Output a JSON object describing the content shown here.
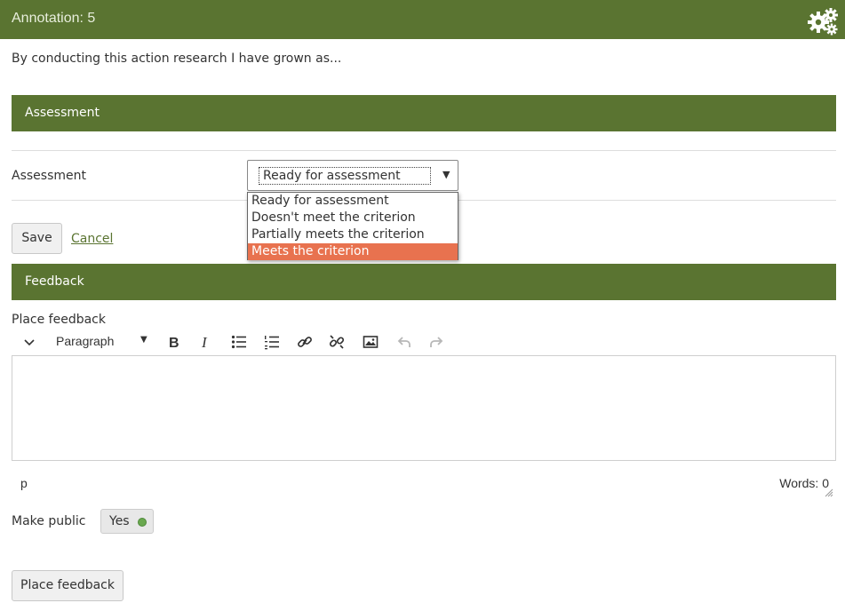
{
  "header": {
    "title": "Annotation: 5",
    "settings_icon": "gears-icon"
  },
  "intro_text": "By conducting this action research I have grown as...",
  "assessment_section": {
    "title": "Assessment",
    "field_label": "Assessment",
    "selected": "Ready for assessment",
    "options": [
      "Ready for assessment",
      "Doesn't meet the criterion",
      "Partially meets the criterion",
      "Meets the criterion"
    ],
    "highlighted_option": "Meets the criterion",
    "save_label": "Save",
    "cancel_label": "Cancel"
  },
  "feedback_section": {
    "title": "Feedback",
    "place_label": "Place feedback",
    "toolbar": {
      "block_format": "Paragraph",
      "icons": [
        "collapse-icon",
        "bold-icon",
        "italic-icon",
        "bullet-list-icon",
        "numbered-list-icon",
        "link-icon",
        "unlink-icon",
        "image-icon",
        "undo-icon",
        "redo-icon"
      ]
    },
    "status_path": "p",
    "word_count": "Words: 0",
    "make_public_label": "Make public",
    "make_public_value": "Yes",
    "submit_label": "Place feedback"
  },
  "colors": {
    "header_green": "#5a7431",
    "highlight": "#e8724f",
    "toggle_dot": "#6aa84f"
  }
}
